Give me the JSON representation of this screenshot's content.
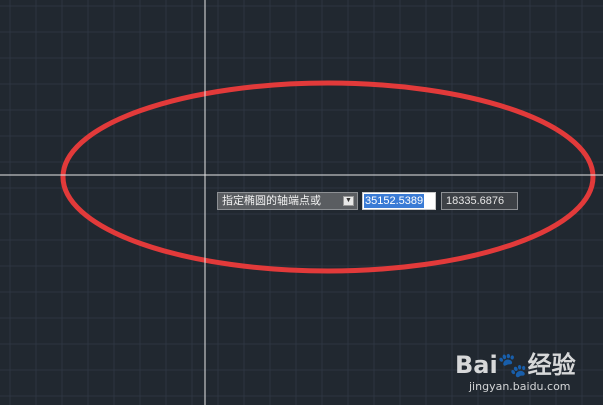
{
  "canvas": {
    "background_color": "#212830",
    "grid_color": "#2d3541",
    "crosshair_color": "#e6e6e6",
    "ellipse_color": "#e23a3a"
  },
  "dynamic_input": {
    "prompt_text": "指定椭圆的轴端点或",
    "options_icon": "down-arrow-icon",
    "x_coordinate": "35152.5389",
    "y_coordinate": "18335.6876"
  },
  "watermark": {
    "logo_text": "Bai🐾经验",
    "url_text": "jingyan.baidu.com"
  }
}
